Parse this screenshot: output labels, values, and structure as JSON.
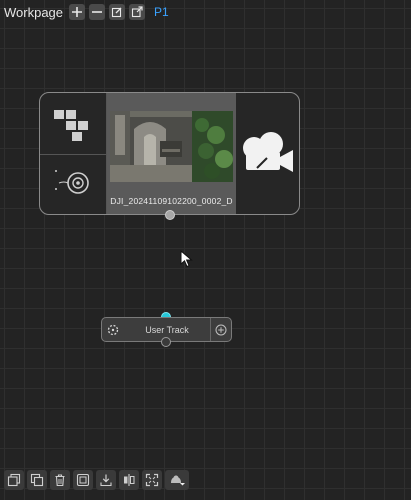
{
  "header": {
    "title": "Workpage",
    "page_tag": "P1",
    "icons": [
      "add-page-icon",
      "remove-page-icon",
      "edit-page-icon",
      "open-external-icon"
    ]
  },
  "source_node": {
    "filename": "DJI_20241109102200_0002_D",
    "icons": [
      "grid-blocks-icon",
      "target-track-icon",
      "video-camera-icon"
    ]
  },
  "track_node": {
    "label": "User Track",
    "icons": [
      "dotted-circle-icon",
      "add-output-icon"
    ]
  },
  "toolbar": {
    "icons": [
      "duplicate-icon",
      "copy-icon",
      "delete-icon",
      "group-icon",
      "import-icon",
      "align-icon",
      "fit-view-icon",
      "node-menu-icon"
    ]
  },
  "colors": {
    "accent_blue": "#3aa2ff",
    "port_cyan": "#25c7d8",
    "background": "#232323"
  }
}
